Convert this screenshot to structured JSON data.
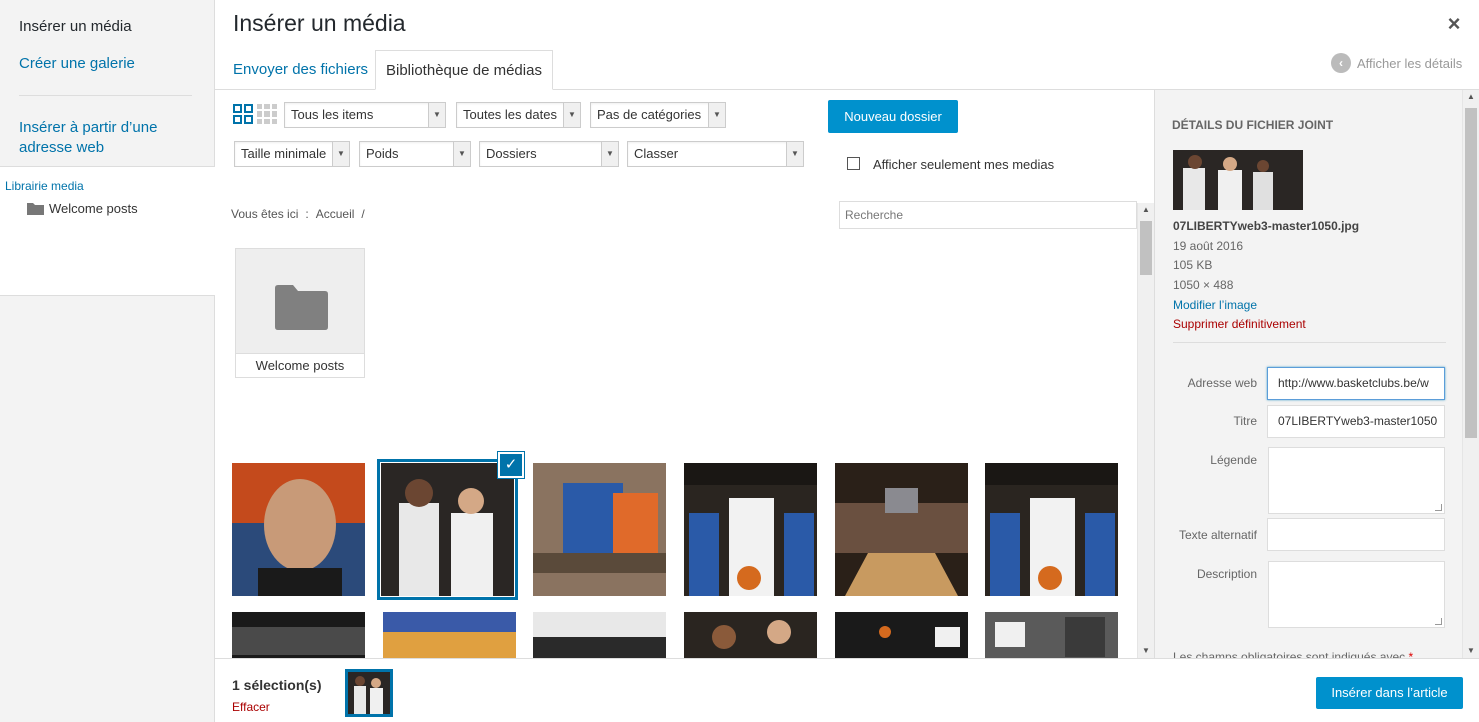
{
  "left_menu": {
    "items": [
      {
        "label": "Insérer un média"
      },
      {
        "label": "Créer une galerie"
      },
      {
        "label": "Insérer à partir d’une"
      },
      {
        "label": "adresse web"
      }
    ],
    "tree": {
      "root": "Librairie media",
      "child": "Welcome posts"
    }
  },
  "header": {
    "title": "Insérer un média",
    "close": "×",
    "tabs": [
      {
        "label": "Envoyer des fichiers"
      },
      {
        "label": "Bibliothèque de médias"
      }
    ],
    "details_toggle": "Afficher les détails"
  },
  "toolbar": {
    "filters_row1": [
      "Tous les items",
      "Toutes les dates",
      "Pas de catégories"
    ],
    "filters_row2": [
      "Taille minimale",
      "Poids",
      "Dossiers",
      "Classer"
    ],
    "new_folder": "Nouveau dossier",
    "only_mine": "Afficher seulement mes medias",
    "search_placeholder": "Recherche"
  },
  "breadcrumb": {
    "prefix": "Vous êtes ici",
    "colon": ":",
    "home": "Accueil",
    "sep": "/"
  },
  "folder": {
    "label": "Welcome posts"
  },
  "details": {
    "title": "Détails du fichier joint",
    "filename": "07LIBERTYweb3-master1050.jpg",
    "date": "19 août 2016",
    "size": "105 KB",
    "dimensions": "1050 × 488",
    "edit_link": "Modifier l’image",
    "delete_link": "Supprimer définitivement",
    "fields": {
      "url_label": "Adresse web",
      "url_value": "http://www.basketclubs.be/w",
      "title_label": "Titre",
      "title_value": "07LIBERTYweb3-master1050",
      "caption_label": "Légende",
      "alt_label": "Texte alternatif",
      "description_label": "Description"
    },
    "required_note": "Les champs obligatoires sont indiqués avec",
    "required_mark": "*"
  },
  "footer": {
    "selection_count": "1 sélection(s)",
    "clear": "Effacer",
    "insert": "Insérer dans l’article"
  },
  "colors": {
    "accent": "#0073aa",
    "button": "#0091cd",
    "danger": "#a00"
  }
}
